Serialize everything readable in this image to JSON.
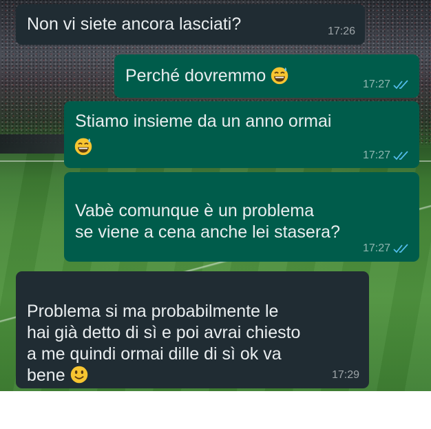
{
  "colors": {
    "incoming_bubble": "#202c33",
    "outgoing_bubble": "#005c4b",
    "message_text": "#e9edef",
    "read_ticks": "#53bdeb"
  },
  "messages": [
    {
      "direction": "incoming",
      "text": "Non vi siete ancora lasciati?",
      "time": "17:26"
    },
    {
      "direction": "outgoing",
      "text": "Perché dovremmo",
      "emoji": "grinning-sweat-emoji",
      "time": "17:27",
      "status": "read"
    },
    {
      "direction": "outgoing",
      "text": "Stiamo insieme da un anno ormai",
      "emoji": "grinning-sweat-emoji",
      "time": "17:27",
      "status": "read"
    },
    {
      "direction": "outgoing",
      "text": "Vabè comunque è un problema\nse viene a cena anche lei stasera?",
      "time": "17:27",
      "status": "read"
    },
    {
      "direction": "incoming",
      "text": "Problema si ma probabilmente le\nhai già detto di sì e poi avrai chiesto\na me quindi ormai dille di sì ok va\nbene",
      "emoji": "slightly-smiling-emoji",
      "time": "17:29"
    }
  ]
}
